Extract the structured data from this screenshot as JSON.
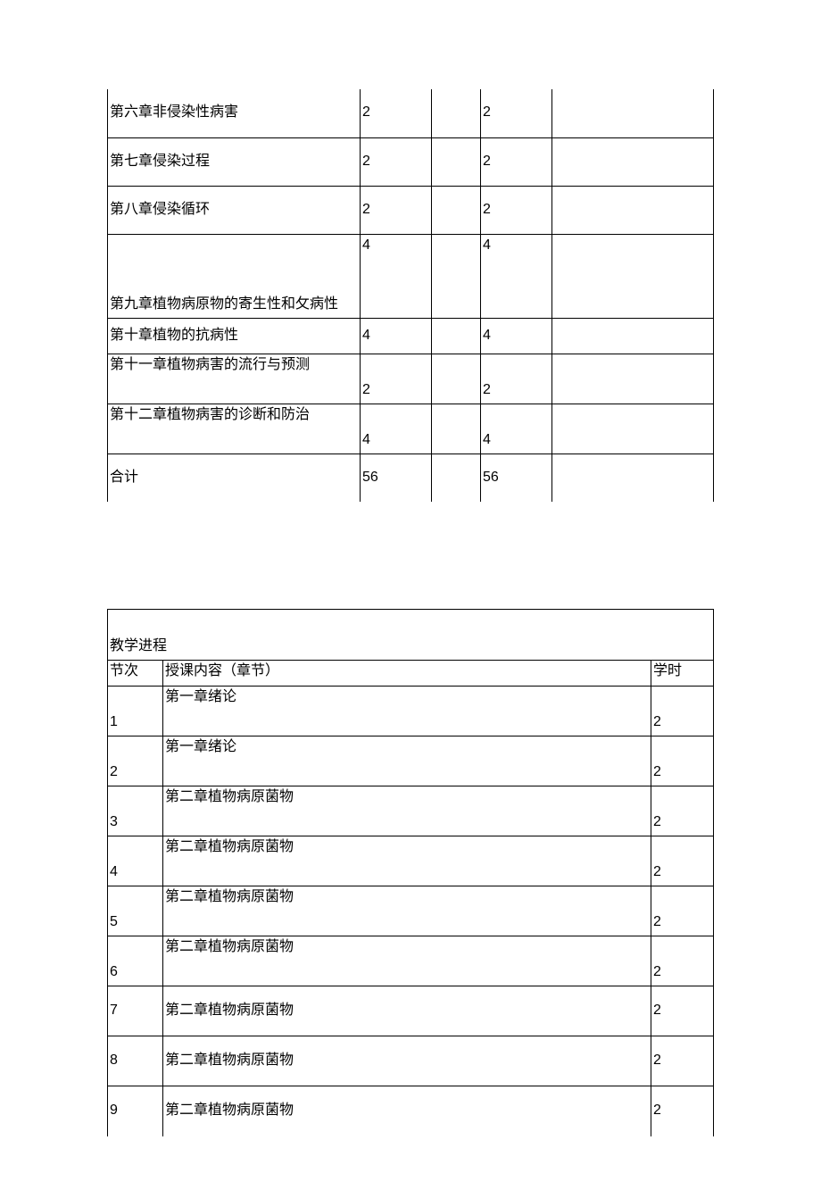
{
  "table1": {
    "rows": [
      {
        "chapter": "第六章非侵染性病害",
        "v1": "2",
        "v2": "",
        "v3": "2",
        "v4": "",
        "h": "row-std",
        "ca": "vmid"
      },
      {
        "chapter": "第七章侵染过程",
        "v1": "2",
        "v2": "",
        "v3": "2",
        "v4": "",
        "h": "row-std",
        "ca": "vmid"
      },
      {
        "chapter": "第八章侵染循环",
        "v1": "2",
        "v2": "",
        "v3": "2",
        "v4": "",
        "h": "row-std",
        "ca": "vmid"
      },
      {
        "chapter": "第九章植物病原物的寄生性和攵病性",
        "v1": "4",
        "v2": "",
        "v3": "4",
        "v4": "",
        "h": "row-tall",
        "ca": "vbottom",
        "na": "vtop"
      },
      {
        "chapter": "第十章植物的抗病性",
        "v1": "4",
        "v2": "",
        "v3": "4",
        "v4": "",
        "h": "row-short",
        "ca": "vmid"
      },
      {
        "chapter": "第十一章植物病害的流行与预测",
        "v1": "2",
        "v2": "",
        "v3": "2",
        "v4": "",
        "h": "row-mid",
        "ca": "vtop",
        "na": "vbottom"
      },
      {
        "chapter": "第十二章植物病害的诊断和防治",
        "v1": "4",
        "v2": "",
        "v3": "4",
        "v4": "",
        "h": "row-mid",
        "ca": "vtop",
        "na": "vbottom"
      },
      {
        "chapter": "合计",
        "v1": "56",
        "v2": "",
        "v3": "56",
        "v4": "",
        "h": "row-std",
        "ca": "vmid"
      }
    ]
  },
  "table2": {
    "title": "教学进程",
    "headers": {
      "c1": "节次",
      "c2": "授课内容（章节）",
      "c3": "学时"
    },
    "rows": [
      {
        "n": "1",
        "content": "第一章绪论",
        "hours": "2",
        "ca": "vtop",
        "na": "vbottom"
      },
      {
        "n": "2",
        "content": "第一章绪论",
        "hours": "2",
        "ca": "vtop",
        "na": "vbottom"
      },
      {
        "n": "3",
        "content": "第二章植物病原菌物",
        "hours": "2",
        "ca": "vtop",
        "na": "vbottom"
      },
      {
        "n": "4",
        "content": "第二章植物病原菌物",
        "hours": "2",
        "ca": "vtop",
        "na": "vbottom"
      },
      {
        "n": "5",
        "content": "第二章植物病原菌物",
        "hours": "2",
        "ca": "vtop",
        "na": "vbottom"
      },
      {
        "n": "6",
        "content": "第二章植物病原菌物",
        "hours": "2",
        "ca": "vtop",
        "na": "vbottom"
      },
      {
        "n": "7",
        "content": "第二章植物病原菌物",
        "hours": "2",
        "ca": "vmid",
        "na": "vmid"
      },
      {
        "n": "8",
        "content": "第二章植物病原菌物",
        "hours": "2",
        "ca": "vmid",
        "na": "vmid"
      },
      {
        "n": "9",
        "content": "第二章植物病原菌物",
        "hours": "2",
        "ca": "vmid",
        "na": "vmid"
      }
    ]
  }
}
